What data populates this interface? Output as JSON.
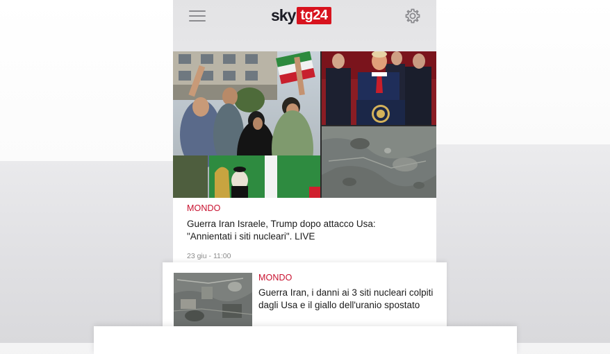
{
  "header": {
    "menu_icon": "hamburger-menu-icon",
    "logo_sky": "sky",
    "logo_tg": "tg24",
    "settings_icon": "gear-icon",
    "brand_color": "#d8131e"
  },
  "hero": {
    "images": [
      "protest-photo",
      "press-conference-photo",
      "satellite-photo"
    ]
  },
  "main_article": {
    "category": "MONDO",
    "headline_line1": "Guerra Iran Israele, Trump dopo attacco Usa:",
    "headline_line2": "\"Annientati i siti nucleari\". LIVE",
    "timestamp": "23 giu - 11:00"
  },
  "second_article": {
    "category": "MONDO",
    "headline_line1": "Guerra Iran, i danni ai 3 siti nucleari colpiti",
    "headline_line2": "dagli Usa e il giallo dell'uranio spostato"
  },
  "colors": {
    "category_red": "#c8102e",
    "text_dark": "#1a1a1a",
    "meta_grey": "#8a8a8a"
  }
}
